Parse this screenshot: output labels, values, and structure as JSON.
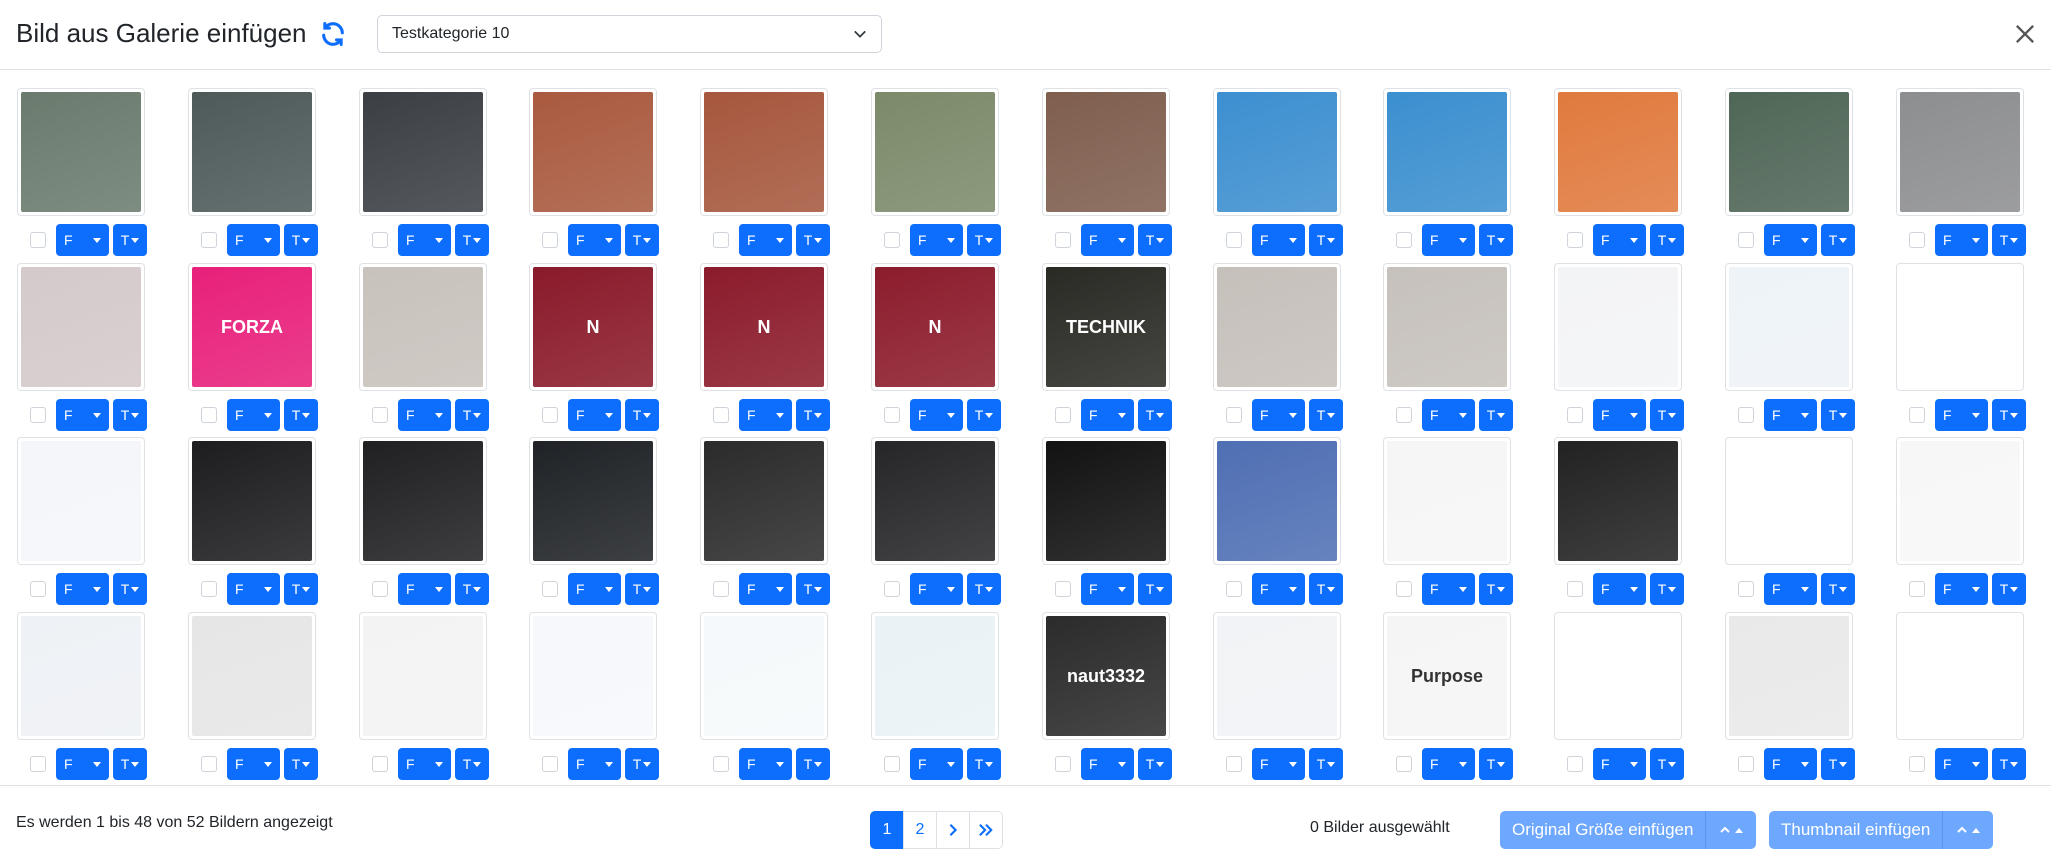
{
  "header": {
    "title": "Bild aus Galerie einfügen",
    "category": "Testkategorie 10"
  },
  "gallery": {
    "button_f": "F",
    "button_t": "T",
    "thumbs": [
      {
        "color": "#6a7b6e",
        "text": ""
      },
      {
        "color": "#4e5a5a",
        "text": ""
      },
      {
        "color": "#3b3f44",
        "text": ""
      },
      {
        "color": "#a95a3f",
        "text": ""
      },
      {
        "color": "#a6573d",
        "text": ""
      },
      {
        "color": "#7c8a6a",
        "text": ""
      },
      {
        "color": "#7f5e4e",
        "text": ""
      },
      {
        "color": "#3d8fd0",
        "text": ""
      },
      {
        "color": "#3b8fcf",
        "text": ""
      },
      {
        "color": "#e07a3e",
        "text": ""
      },
      {
        "color": "#4f6656",
        "text": ""
      },
      {
        "color": "#8d8e90",
        "text": ""
      },
      {
        "color": "#d4c9cb",
        "text": ""
      },
      {
        "color": "#e8207b",
        "text": "FORZA"
      },
      {
        "color": "#c8c2bc",
        "text": ""
      },
      {
        "color": "#8a1a2a",
        "text": "N"
      },
      {
        "color": "#8b1b2b",
        "text": "N"
      },
      {
        "color": "#8c1c2c",
        "text": "N"
      },
      {
        "color": "#2a2a25",
        "text": "TECHNIK"
      },
      {
        "color": "#c6c0bb",
        "text": ""
      },
      {
        "color": "#c6c1bc",
        "text": ""
      },
      {
        "color": "#f3f4f6",
        "text": ""
      },
      {
        "color": "#eef3f8",
        "text": ""
      },
      {
        "color": "#ffffff",
        "text": ""
      },
      {
        "color": "#f4f6f9",
        "text": ""
      },
      {
        "color": "#1d1d1f",
        "text": ""
      },
      {
        "color": "#202022",
        "text": ""
      },
      {
        "color": "#1f2226",
        "text": ""
      },
      {
        "color": "#2b2b2b",
        "text": ""
      },
      {
        "color": "#262629",
        "text": ""
      },
      {
        "color": "#121212",
        "text": ""
      },
      {
        "color": "#4f6fb4",
        "text": ""
      },
      {
        "color": "#f6f6f6",
        "text": ""
      },
      {
        "color": "#222222",
        "text": ""
      },
      {
        "color": "#ffffff",
        "text": ""
      },
      {
        "color": "#f7f7f7",
        "text": ""
      },
      {
        "color": "#eef1f5",
        "text": ""
      },
      {
        "color": "#e6e6e6",
        "text": ""
      },
      {
        "color": "#f3f3f3",
        "text": ""
      },
      {
        "color": "#f6f8fb",
        "text": ""
      },
      {
        "color": "#f6f9fb",
        "text": ""
      },
      {
        "color": "#eaf2f6",
        "text": ""
      },
      {
        "color": "#2b2b2b",
        "text": "naut3332"
      },
      {
        "color": "#f1f3f6",
        "text": ""
      },
      {
        "color": "#f5f5f5",
        "text": "Purpose"
      },
      {
        "color": "#ffffff",
        "text": ""
      },
      {
        "color": "#e9e9e9",
        "text": ""
      },
      {
        "color": "#ffffff",
        "text": ""
      }
    ]
  },
  "footer": {
    "info": "Es werden 1 bis 48 von 52 Bildern angezeigt",
    "pages": [
      "1",
      "2"
    ],
    "next_icon": "chevron-right-icon",
    "last_icon": "chevrons-right-icon",
    "selected": "0 Bilder ausgewählt",
    "insert_original": "Original Größe einfügen",
    "insert_thumbnail": "Thumbnail einfügen"
  }
}
